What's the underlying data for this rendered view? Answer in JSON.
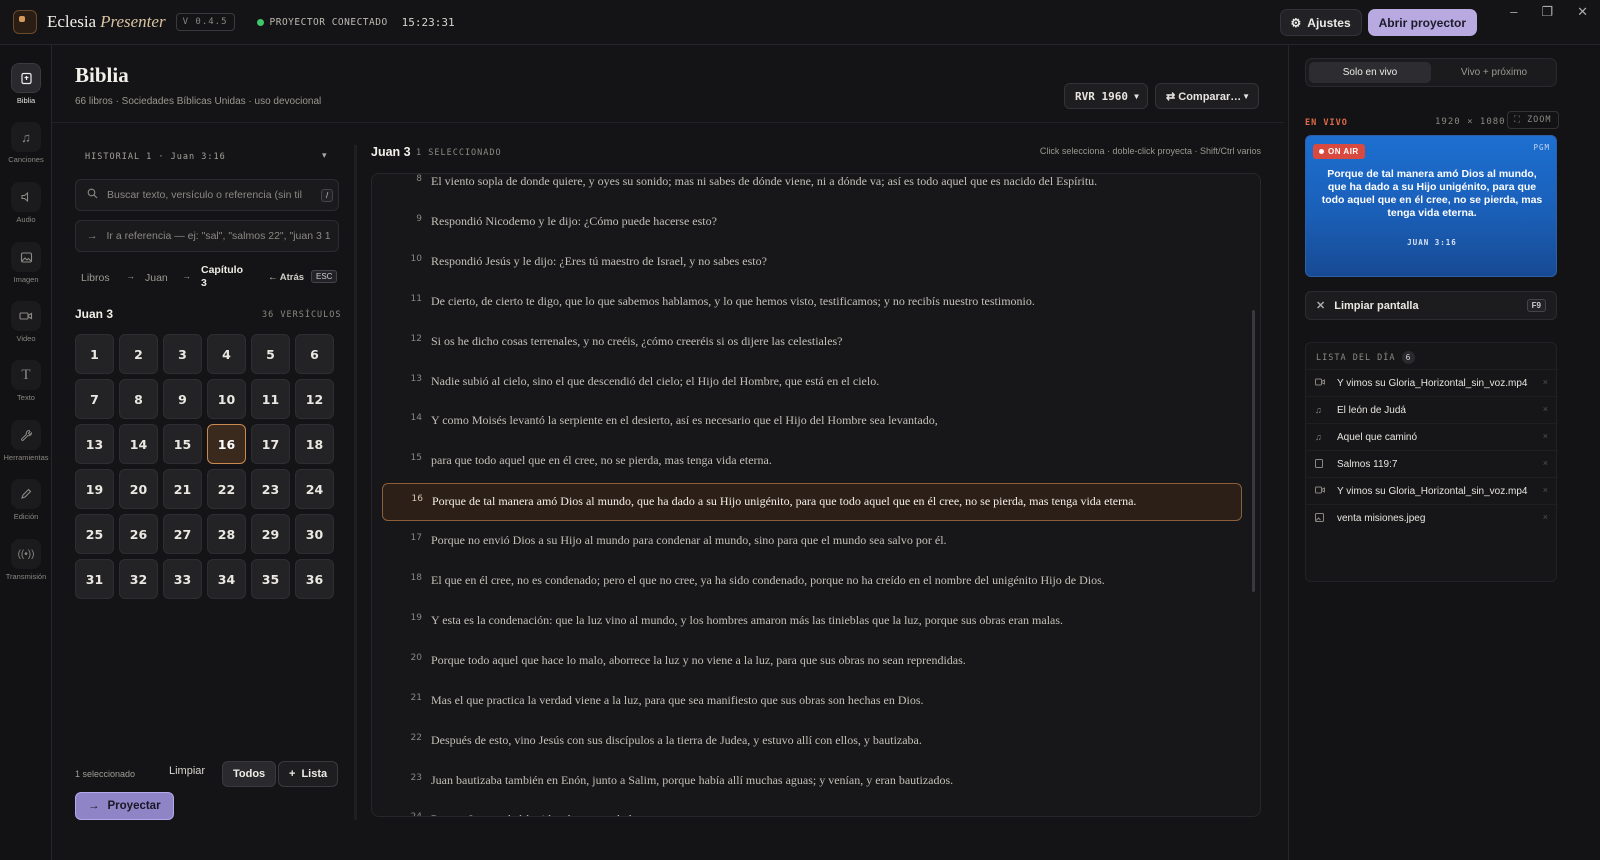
{
  "app": {
    "name_a": "Eclesia",
    "name_b": "Presenter",
    "version": "V 0.4.5",
    "status": "PROYECTOR CONECTADO",
    "clock": "15:23:31"
  },
  "toolbar": {
    "settings": "Ajustes",
    "open_projector": "Abrir proyector"
  },
  "window": {
    "minimize": "–",
    "maximize": "❐",
    "close": "✕"
  },
  "rail": [
    {
      "label": "Biblia",
      "icon": "book-icon"
    },
    {
      "label": "Canciones",
      "icon": "music-icon"
    },
    {
      "label": "Audio",
      "icon": "speaker-icon"
    },
    {
      "label": "Imagen",
      "icon": "image-icon"
    },
    {
      "label": "Video",
      "icon": "video-icon"
    },
    {
      "label": "Texto",
      "icon": "text-icon"
    },
    {
      "label": "Herramientas",
      "icon": "wrench-icon"
    },
    {
      "label": "Edición",
      "icon": "pencil-icon"
    },
    {
      "label": "Transmisión",
      "icon": "broadcast-icon"
    }
  ],
  "header": {
    "title": "Biblia",
    "subtitle": "66 libros · Sociedades Bíblicas Unidas · uso devocional",
    "version_select": "RVR 1960",
    "compare": "⇄ Comparar…"
  },
  "left": {
    "history": "HISTORIAL 1 · Juan 3:16",
    "search_placeholder": "Buscar texto, versículo o referencia (sin til",
    "search_key": "/",
    "goto_placeholder": "Ir a referencia — ej: \"sal\", \"salmos 22\", \"juan 3 1",
    "crumbs": {
      "books": "Libros",
      "book": "Juan",
      "chapter": "Capítulo 3",
      "back": "← Atrás",
      "esc": "ESC"
    },
    "chapter_title": "Juan 3",
    "verse_count": "36 VERSÍCULOS",
    "verses": [
      "1",
      "2",
      "3",
      "4",
      "5",
      "6",
      "7",
      "8",
      "9",
      "10",
      "11",
      "12",
      "13",
      "14",
      "15",
      "16",
      "17",
      "18",
      "19",
      "20",
      "21",
      "22",
      "23",
      "24",
      "25",
      "26",
      "27",
      "28",
      "29",
      "30",
      "31",
      "32",
      "33",
      "34",
      "35",
      "36"
    ],
    "active_verse": "16",
    "selected": "1 seleccionado",
    "clear": "Limpiar",
    "all": "Todos",
    "list": "Lista",
    "project": "Proyectar"
  },
  "verses_panel": {
    "title": "Juan 3",
    "selected": "1 SELECCIONADO",
    "hint": "Click selecciona · doble-click proyecta · Shift/Ctrl varios",
    "items": [
      {
        "n": "8",
        "text": "El viento sopla de donde quiere, y oyes su sonido; mas ni sabes de dónde viene, ni a dónde va; así es todo aquel que es nacido del Espíritu."
      },
      {
        "n": "9",
        "text": "Respondió Nicodemo y le dijo: ¿Cómo puede hacerse esto?"
      },
      {
        "n": "10",
        "text": "Respondió Jesús y le dijo: ¿Eres tú maestro de Israel, y no sabes esto?"
      },
      {
        "n": "11",
        "text": "De cierto, de cierto te digo, que lo que sabemos hablamos, y lo que hemos visto, testificamos; y no recibís nuestro testimonio."
      },
      {
        "n": "12",
        "text": "Si os he dicho cosas terrenales, y no creéis, ¿cómo creeréis si os dijere las celestiales?"
      },
      {
        "n": "13",
        "text": "Nadie subió al cielo, sino el que descendió del cielo; el Hijo del Hombre, que está en el cielo."
      },
      {
        "n": "14",
        "text": "Y como Moisés levantó la serpiente en el desierto, así es necesario que el Hijo del Hombre sea levantado,"
      },
      {
        "n": "15",
        "text": "para que todo aquel que en él cree, no se pierda, mas tenga vida eterna."
      },
      {
        "n": "16",
        "text": "Porque de tal manera amó Dios al mundo, que ha dado a su Hijo unigénito, para que todo aquel que en él cree, no se pierda, mas tenga vida eterna."
      },
      {
        "n": "17",
        "text": "Porque no envió Dios a su Hijo al mundo para condenar al mundo, sino para que el mundo sea salvo por él."
      },
      {
        "n": "18",
        "text": "El que en él cree, no es condenado; pero el que no cree, ya ha sido condenado, porque no ha creído en el nombre del unigénito Hijo de Dios."
      },
      {
        "n": "19",
        "text": "Y esta es la condenación: que la luz vino al mundo, y los hombres amaron más las tinieblas que la luz, porque sus obras eran malas."
      },
      {
        "n": "20",
        "text": "Porque todo aquel que hace lo malo, aborrece la luz y no viene a la luz, para que sus obras no sean reprendidas."
      },
      {
        "n": "21",
        "text": "Mas el que practica la verdad viene a la luz, para que sea manifiesto que sus obras son hechas en Dios."
      },
      {
        "n": "22",
        "text": "Después de esto, vino Jesús con sus discípulos a la tierra de Judea, y estuvo allí con ellos, y bautizaba."
      },
      {
        "n": "23",
        "text": "Juan bautizaba también en Enón, junto a Salim, porque había allí muchas aguas; y venían, y eran bautizados."
      },
      {
        "n": "24",
        "text": "Porque Juan no había sido aún encarcelado."
      }
    ]
  },
  "right": {
    "tab_live": "Solo en vivo",
    "tab_next": "Vivo + próximo",
    "live_label": "EN VIVO",
    "resolution": "1920 × 1080",
    "zoom": "⛶ ZOOM",
    "on_air": "ON AIR",
    "pgm": "PGM",
    "preview_text": "Porque de tal manera amó Dios al mundo, que ha dado a su Hijo unigénito, para que todo aquel que en él cree, no se pierda, mas tenga vida eterna.",
    "preview_ref": "JUAN 3:16",
    "clear_screen": "Limpiar pantalla",
    "clear_key": "F9",
    "list_title": "LISTA DEL DÍA",
    "list_count": "6",
    "list": [
      {
        "label": "Y vimos su Gloria_Horizontal_sin_voz.mp4",
        "icon": "video-icon"
      },
      {
        "label": "El león de Judá",
        "icon": "music-icon"
      },
      {
        "label": "Aquel que caminó",
        "icon": "music-icon"
      },
      {
        "label": "Salmos 119:7",
        "icon": "book-icon"
      },
      {
        "label": "Y vimos su Gloria_Horizontal_sin_voz.mp4",
        "icon": "video-icon"
      },
      {
        "label": "venta misiones.jpeg",
        "icon": "image-icon"
      }
    ]
  },
  "colors": {
    "accent": "#b8a9e0",
    "live": "#e06a4a",
    "preview_bg": "#1d6fd1",
    "selection": "#c9894f"
  }
}
